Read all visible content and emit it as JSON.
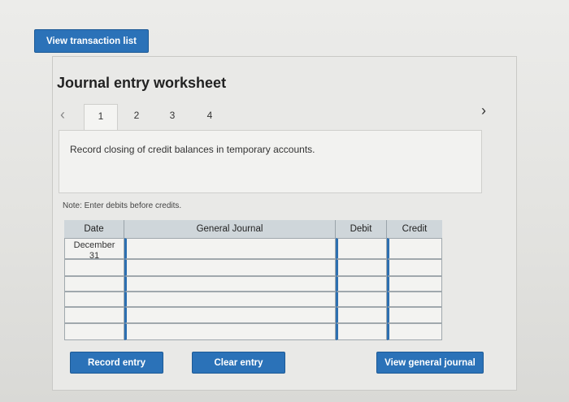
{
  "top": {
    "view_transaction_list": "View transaction list"
  },
  "worksheet": {
    "title": "Journal entry worksheet",
    "prev_icon": "chevron-left-icon",
    "next_icon": "chevron-right-icon",
    "tabs": [
      "1",
      "2",
      "3",
      "4"
    ],
    "active_tab": "1",
    "instruction": "Record closing of credit balances in temporary accounts.",
    "note": "Note: Enter debits before credits."
  },
  "table": {
    "headers": {
      "date": "Date",
      "general_journal": "General Journal",
      "debit": "Debit",
      "credit": "Credit"
    },
    "rows": [
      {
        "date_month": "December",
        "date_day": "31",
        "account": "",
        "debit": "",
        "credit": ""
      },
      {
        "date_month": "",
        "date_day": "",
        "account": "",
        "debit": "",
        "credit": ""
      },
      {
        "date_month": "",
        "date_day": "",
        "account": "",
        "debit": "",
        "credit": ""
      },
      {
        "date_month": "",
        "date_day": "",
        "account": "",
        "debit": "",
        "credit": ""
      },
      {
        "date_month": "",
        "date_day": "",
        "account": "",
        "debit": "",
        "credit": ""
      },
      {
        "date_month": "",
        "date_day": "",
        "account": "",
        "debit": "",
        "credit": ""
      }
    ]
  },
  "buttons": {
    "record_entry": "Record entry",
    "clear_entry": "Clear entry",
    "view_general_journal": "View general journal"
  },
  "colors": {
    "button_blue": "#2b72b8",
    "input_accent": "#2d6fb0"
  }
}
